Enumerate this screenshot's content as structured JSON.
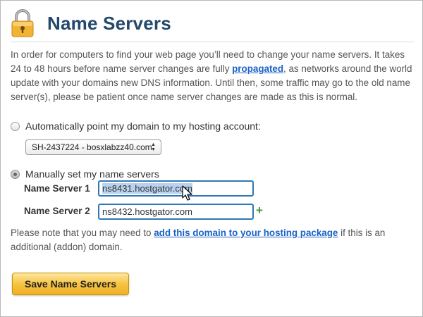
{
  "page": {
    "title": "Name Servers",
    "icon": "lock-icon"
  },
  "intro": {
    "text_before": "In order for computers to find your web page you’ll need to change your name servers. It takes 24 to 48 hours before name server changes are fully ",
    "link": "propagated",
    "text_after": ", as networks around the world update with your domains new DNS information. Until then, some traffic may go to the old name server(s), please be patient once name server changes are made as this is normal."
  },
  "options": {
    "auto": {
      "label": "Automatically point my domain to my hosting account:",
      "selected": false,
      "select_value": "SH-2437224 - bosxlabzz40.com"
    },
    "manual": {
      "label": "Manually set my name servers",
      "selected": true
    }
  },
  "name_servers": [
    {
      "label": "Name Server 1",
      "value": "ns8431.hostgator.com",
      "text_selected": true
    },
    {
      "label": "Name Server 2",
      "value": "ns8432.hostgator.com",
      "text_selected": false
    }
  ],
  "add_icon": "plus-icon",
  "note": {
    "text_before": "Please note that you may need to ",
    "link": "add this domain to your hosting package",
    "text_after": " if this is an additional (addon) domain."
  },
  "save_button": {
    "label": "Save Name Servers"
  },
  "colors": {
    "title": "#24486c",
    "link": "#1a63c6",
    "input_border": "#2f78b8",
    "button": "#f7c443",
    "plus": "#3d9a2b",
    "lock_body": "#f2b233"
  }
}
